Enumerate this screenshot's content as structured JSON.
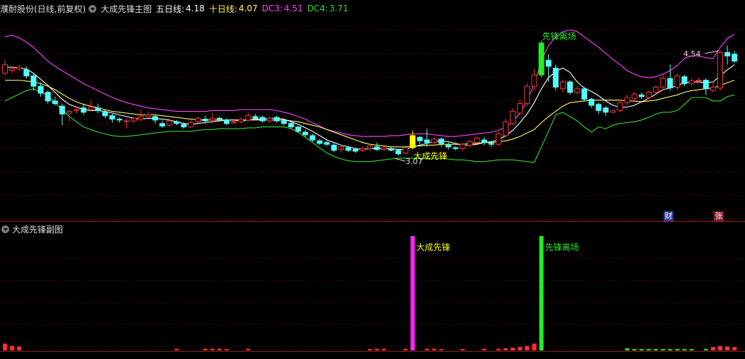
{
  "header": {
    "stock_name": "濮耐股份(日线,前复权)",
    "indicator_name": "大成先锋主图",
    "ma5_label": "五日线:",
    "ma5_value": "4.18",
    "ma10_label": "十日线:",
    "ma10_value": "4.07",
    "dc3_label": "DC3:",
    "dc3_value": "4.51",
    "dc4_label": "DC4:",
    "dc4_value": "3.71"
  },
  "sub_header": {
    "indicator_name": "大成先锋副图"
  },
  "badges": {
    "cai": "财",
    "zhang": "张"
  },
  "colors": {
    "up": "#ff3232",
    "down": "#54ffff",
    "ma5": "#ffffff",
    "ma10": "#ffff66",
    "dc3": "#ff44ff",
    "dc4": "#33dd33",
    "buy": "#ff22ff",
    "sell": "#22ee22",
    "buy_candle": "#ffff00",
    "sell_candle": "#22ee22"
  },
  "chart_data": [
    {
      "type": "candlestick",
      "title": "大成先锋主图",
      "ylim": [
        2.6,
        4.95
      ],
      "ohlc": [
        [
          4.3,
          4.4,
          4.28,
          4.46
        ],
        [
          4.33,
          4.35,
          4.3,
          4.38
        ],
        [
          4.35,
          4.37,
          4.33,
          4.4
        ],
        [
          4.34,
          4.27,
          4.24,
          4.38
        ],
        [
          4.27,
          4.15,
          4.1,
          4.29
        ],
        [
          4.15,
          4.07,
          4.03,
          4.19
        ],
        [
          4.08,
          3.98,
          3.95,
          4.1
        ],
        [
          3.98,
          3.95,
          3.93,
          4.03
        ],
        [
          3.92,
          3.83,
          3.7,
          3.95
        ],
        [
          3.84,
          3.86,
          3.74,
          3.88
        ],
        [
          3.87,
          3.88,
          3.84,
          3.9
        ],
        [
          3.9,
          3.85,
          3.82,
          3.95
        ],
        [
          3.88,
          3.91,
          3.86,
          3.99
        ],
        [
          3.9,
          3.87,
          3.84,
          3.95
        ],
        [
          3.85,
          3.81,
          3.78,
          3.88
        ],
        [
          3.81,
          3.77,
          3.73,
          3.83
        ],
        [
          3.77,
          3.76,
          3.73,
          3.79
        ],
        [
          3.74,
          3.75,
          3.66,
          3.77
        ],
        [
          3.75,
          3.78,
          3.72,
          3.8
        ],
        [
          3.77,
          3.8,
          3.74,
          3.88
        ],
        [
          3.8,
          3.82,
          3.78,
          3.86
        ],
        [
          3.8,
          3.76,
          3.72,
          3.82
        ],
        [
          3.72,
          3.69,
          3.67,
          3.75
        ],
        [
          3.7,
          3.75,
          3.68,
          3.77
        ],
        [
          3.74,
          3.72,
          3.7,
          3.76
        ],
        [
          3.71,
          3.68,
          3.66,
          3.73
        ],
        [
          3.68,
          3.73,
          3.67,
          3.76
        ],
        [
          3.74,
          3.78,
          3.72,
          3.8
        ],
        [
          3.77,
          3.75,
          3.72,
          3.81
        ],
        [
          3.76,
          3.78,
          3.74,
          3.84
        ],
        [
          3.78,
          3.77,
          3.75,
          3.8
        ],
        [
          3.76,
          3.72,
          3.7,
          3.78
        ],
        [
          3.74,
          3.74,
          3.71,
          3.76
        ],
        [
          3.74,
          3.77,
          3.72,
          3.79
        ],
        [
          3.76,
          3.81,
          3.74,
          3.84
        ],
        [
          3.8,
          3.78,
          3.76,
          3.83
        ],
        [
          3.79,
          3.75,
          3.73,
          3.81
        ],
        [
          3.75,
          3.78,
          3.73,
          3.8
        ],
        [
          3.79,
          3.75,
          3.73,
          3.81
        ],
        [
          3.75,
          3.72,
          3.7,
          3.77
        ],
        [
          3.72,
          3.68,
          3.66,
          3.74
        ],
        [
          3.68,
          3.63,
          3.61,
          3.69
        ],
        [
          3.62,
          3.59,
          3.56,
          3.64
        ],
        [
          3.58,
          3.53,
          3.51,
          3.6
        ],
        [
          3.52,
          3.49,
          3.47,
          3.54
        ],
        [
          3.5,
          3.48,
          3.46,
          3.52
        ],
        [
          3.47,
          3.41,
          3.39,
          3.49
        ],
        [
          3.42,
          3.45,
          3.38,
          3.47
        ],
        [
          3.44,
          3.41,
          3.39,
          3.46
        ],
        [
          3.42,
          3.4,
          3.38,
          3.44
        ],
        [
          3.41,
          3.43,
          3.39,
          3.45
        ],
        [
          3.43,
          3.46,
          3.4,
          3.49
        ],
        [
          3.45,
          3.42,
          3.4,
          3.5
        ],
        [
          3.42,
          3.44,
          3.4,
          3.46
        ],
        [
          3.43,
          3.41,
          3.4,
          3.45
        ],
        [
          3.41,
          3.37,
          3.35,
          3.43
        ],
        [
          3.38,
          3.44,
          3.36,
          3.46
        ],
        [
          3.44,
          3.58,
          3.42,
          3.64
        ],
        [
          3.56,
          3.52,
          3.48,
          3.58
        ],
        [
          3.53,
          3.5,
          3.45,
          3.66
        ],
        [
          3.5,
          3.54,
          3.46,
          3.57
        ],
        [
          3.54,
          3.49,
          3.45,
          3.56
        ],
        [
          3.47,
          3.45,
          3.42,
          3.5
        ],
        [
          3.44,
          3.43,
          3.41,
          3.46
        ],
        [
          3.43,
          3.48,
          3.41,
          3.5
        ],
        [
          3.47,
          3.51,
          3.45,
          3.53
        ],
        [
          3.5,
          3.55,
          3.48,
          3.57
        ],
        [
          3.53,
          3.5,
          3.47,
          3.56
        ],
        [
          3.49,
          3.48,
          3.45,
          3.52
        ],
        [
          3.48,
          3.6,
          3.46,
          3.62
        ],
        [
          3.58,
          3.74,
          3.55,
          3.78
        ],
        [
          3.72,
          3.86,
          3.7,
          3.9
        ],
        [
          3.84,
          3.95,
          3.82,
          4.0
        ],
        [
          3.95,
          4.15,
          3.92,
          4.18
        ],
        [
          4.15,
          4.28,
          4.1,
          4.35
        ],
        [
          4.28,
          4.65,
          4.25,
          4.68
        ],
        [
          4.45,
          4.38,
          4.2,
          4.52
        ],
        [
          4.36,
          4.14,
          4.1,
          4.4
        ],
        [
          4.12,
          4.2,
          4.08,
          4.22
        ],
        [
          4.2,
          4.08,
          4.05,
          4.22
        ],
        [
          4.08,
          4.12,
          4.05,
          4.15
        ],
        [
          4.12,
          4.0,
          3.98,
          4.14
        ],
        [
          4.0,
          3.93,
          3.9,
          4.02
        ],
        [
          3.94,
          3.87,
          3.83,
          3.96
        ],
        [
          3.9,
          3.85,
          3.81,
          3.92
        ],
        [
          3.85,
          3.87,
          3.84,
          3.88
        ],
        [
          3.87,
          3.96,
          3.85,
          4.0
        ],
        [
          3.96,
          4.02,
          3.93,
          4.05
        ],
        [
          4.01,
          4.06,
          3.98,
          4.08
        ],
        [
          4.05,
          4.03,
          4.0,
          4.08
        ],
        [
          4.02,
          4.08,
          4.0,
          4.1
        ],
        [
          4.08,
          4.14,
          4.05,
          4.16
        ],
        [
          4.14,
          4.24,
          4.1,
          4.29
        ],
        [
          4.24,
          4.13,
          4.1,
          4.4
        ],
        [
          4.14,
          4.27,
          4.1,
          4.3
        ],
        [
          4.26,
          4.18,
          4.15,
          4.28
        ],
        [
          4.18,
          4.21,
          4.16,
          4.24
        ],
        [
          4.21,
          4.22,
          4.19,
          4.25
        ],
        [
          4.22,
          4.12,
          4.05,
          4.24
        ],
        [
          4.1,
          4.14,
          4.08,
          4.2
        ],
        [
          4.13,
          4.54,
          4.1,
          4.56
        ],
        [
          4.54,
          4.5,
          4.4,
          4.62
        ],
        [
          4.52,
          4.44,
          4.42,
          4.56
        ]
      ],
      "ma5": [
        4.37,
        4.37,
        4.36,
        4.35,
        4.3,
        4.23,
        4.16,
        4.08,
        4.0,
        3.94,
        3.91,
        3.88,
        3.87,
        3.87,
        3.86,
        3.84,
        3.82,
        3.8,
        3.78,
        3.77,
        3.78,
        3.78,
        3.77,
        3.76,
        3.74,
        3.72,
        3.71,
        3.72,
        3.73,
        3.74,
        3.75,
        3.76,
        3.76,
        3.75,
        3.76,
        3.77,
        3.77,
        3.78,
        3.78,
        3.77,
        3.74,
        3.71,
        3.67,
        3.63,
        3.58,
        3.53,
        3.5,
        3.47,
        3.45,
        3.43,
        3.42,
        3.43,
        3.43,
        3.43,
        3.43,
        3.42,
        3.42,
        3.45,
        3.47,
        3.49,
        3.51,
        3.52,
        3.51,
        3.49,
        3.47,
        3.47,
        3.48,
        3.5,
        3.51,
        3.53,
        3.58,
        3.64,
        3.73,
        3.83,
        3.96,
        4.12,
        4.25,
        4.32,
        4.36,
        4.31,
        4.2,
        4.13,
        4.09,
        4.04,
        3.98,
        3.93,
        3.91,
        3.91,
        3.93,
        3.97,
        4.01,
        4.06,
        4.11,
        4.13,
        4.16,
        4.19,
        4.2,
        4.2,
        4.19,
        4.2,
        4.27,
        4.34,
        4.4
      ],
      "ma10": [
        4.22,
        4.22,
        4.22,
        4.21,
        4.2,
        4.18,
        4.15,
        4.11,
        4.06,
        4.01,
        3.97,
        3.94,
        3.92,
        3.9,
        3.88,
        3.86,
        3.85,
        3.84,
        3.83,
        3.82,
        3.82,
        3.82,
        3.81,
        3.8,
        3.79,
        3.78,
        3.77,
        3.76,
        3.76,
        3.76,
        3.76,
        3.76,
        3.76,
        3.76,
        3.76,
        3.76,
        3.76,
        3.76,
        3.76,
        3.76,
        3.75,
        3.74,
        3.72,
        3.7,
        3.68,
        3.65,
        3.62,
        3.59,
        3.56,
        3.53,
        3.5,
        3.48,
        3.47,
        3.46,
        3.45,
        3.45,
        3.45,
        3.46,
        3.46,
        3.47,
        3.47,
        3.48,
        3.48,
        3.48,
        3.48,
        3.49,
        3.49,
        3.5,
        3.5,
        3.51,
        3.52,
        3.54,
        3.57,
        3.61,
        3.65,
        3.73,
        3.8,
        3.86,
        3.92,
        3.96,
        3.97,
        3.98,
        3.99,
        3.99,
        3.99,
        3.99,
        3.99,
        3.98,
        3.98,
        3.97,
        3.98,
        3.99,
        4.01,
        4.03,
        4.05,
        4.08,
        4.1,
        4.11,
        4.12,
        4.13,
        4.16,
        4.19,
        4.22
      ],
      "dc3": [
        4.72,
        4.74,
        4.71,
        4.66,
        4.6,
        4.52,
        4.44,
        4.38,
        4.33,
        4.28,
        4.23,
        4.18,
        4.14,
        4.1,
        4.06,
        4.02,
        3.99,
        3.96,
        3.94,
        3.92,
        3.9,
        3.89,
        3.88,
        3.87,
        3.86,
        3.86,
        3.86,
        3.86,
        3.86,
        3.87,
        3.87,
        3.87,
        3.87,
        3.88,
        3.88,
        3.88,
        3.88,
        3.88,
        3.87,
        3.85,
        3.83,
        3.8,
        3.77,
        3.73,
        3.69,
        3.65,
        3.63,
        3.61,
        3.59,
        3.58,
        3.57,
        3.57,
        3.57,
        3.57,
        3.58,
        3.58,
        3.59,
        3.6,
        3.6,
        3.6,
        3.59,
        3.58,
        3.57,
        3.57,
        3.58,
        3.59,
        3.6,
        3.61,
        3.62,
        3.64,
        3.68,
        3.74,
        3.84,
        3.98,
        4.18,
        4.44,
        4.62,
        4.72,
        4.78,
        4.8,
        4.78,
        4.72,
        4.66,
        4.6,
        4.53,
        4.46,
        4.4,
        4.33,
        4.29,
        4.26,
        4.25,
        4.26,
        4.29,
        4.33,
        4.39,
        4.47,
        4.5,
        4.5,
        4.48,
        4.47,
        4.6,
        4.7,
        4.75
      ],
      "dc4": [
        3.98,
        4.02,
        4.06,
        4.1,
        4.12,
        4.08,
        4.04,
        3.96,
        3.88,
        3.8,
        3.74,
        3.68,
        3.65,
        3.62,
        3.6,
        3.58,
        3.57,
        3.57,
        3.58,
        3.59,
        3.6,
        3.61,
        3.62,
        3.63,
        3.63,
        3.63,
        3.63,
        3.64,
        3.65,
        3.65,
        3.66,
        3.66,
        3.66,
        3.66,
        3.67,
        3.67,
        3.68,
        3.68,
        3.68,
        3.68,
        3.66,
        3.62,
        3.56,
        3.5,
        3.44,
        3.38,
        3.34,
        3.31,
        3.29,
        3.28,
        3.28,
        3.28,
        3.29,
        3.3,
        3.31,
        3.32,
        3.32,
        3.32,
        3.32,
        3.32,
        3.32,
        3.32,
        3.31,
        3.3,
        3.3,
        3.29,
        3.28,
        3.28,
        3.29,
        3.3,
        3.3,
        3.3,
        3.29,
        3.28,
        3.27,
        3.45,
        3.63,
        3.82,
        3.85,
        3.8,
        3.75,
        3.68,
        3.62,
        3.68,
        3.66,
        3.7,
        3.72,
        3.73,
        3.74,
        3.76,
        3.79,
        3.83,
        3.85,
        3.85,
        3.87,
        3.94,
        4.02,
        4.02,
        4.02,
        3.98,
        3.98,
        4.03,
        4.05
      ],
      "annotations": {
        "high_label": "4.54",
        "low_label": "3.07",
        "buy_text": "大成先锋",
        "sell_text": "先锋离场",
        "buy_index": 57,
        "sell_index": 75,
        "high_index": 100,
        "low_index": 55
      }
    },
    {
      "type": "bar",
      "title": "大成先锋副图",
      "buy_signal": {
        "index": 57,
        "label": "大成先锋"
      },
      "sell_signal": {
        "index": 75,
        "label": "先锋离场"
      },
      "small_bars": [
        {
          "i": 0,
          "v": 0.06,
          "c": "up"
        },
        {
          "i": 1,
          "v": 0.04,
          "c": "up"
        },
        {
          "i": 2,
          "v": 0.035,
          "c": "up"
        },
        {
          "i": 24,
          "v": 0.015,
          "c": "up"
        },
        {
          "i": 28,
          "v": 0.015,
          "c": "up"
        },
        {
          "i": 29,
          "v": 0.015,
          "c": "up"
        },
        {
          "i": 30,
          "v": 0.015,
          "c": "up"
        },
        {
          "i": 31,
          "v": 0.012,
          "c": "up"
        },
        {
          "i": 34,
          "v": 0.015,
          "c": "up"
        },
        {
          "i": 51,
          "v": 0.012,
          "c": "up"
        },
        {
          "i": 52,
          "v": 0.015,
          "c": "up"
        },
        {
          "i": 53,
          "v": 0.015,
          "c": "up"
        },
        {
          "i": 56,
          "v": 0.015,
          "c": "up"
        },
        {
          "i": 59,
          "v": 0.015,
          "c": "up"
        },
        {
          "i": 60,
          "v": 0.015,
          "c": "up"
        },
        {
          "i": 61,
          "v": 0.012,
          "c": "up"
        },
        {
          "i": 64,
          "v": 0.012,
          "c": "up"
        },
        {
          "i": 67,
          "v": 0.015,
          "c": "up"
        },
        {
          "i": 69,
          "v": 0.015,
          "c": "up"
        },
        {
          "i": 70,
          "v": 0.02,
          "c": "up"
        },
        {
          "i": 71,
          "v": 0.025,
          "c": "up"
        },
        {
          "i": 72,
          "v": 0.03,
          "c": "up"
        },
        {
          "i": 73,
          "v": 0.04,
          "c": "up"
        },
        {
          "i": 74,
          "v": 0.06,
          "c": "up"
        },
        {
          "i": 87,
          "v": 0.02,
          "c": "sell"
        },
        {
          "i": 88,
          "v": 0.01,
          "c": "sell"
        },
        {
          "i": 89,
          "v": 0.008,
          "c": "sell"
        },
        {
          "i": 90,
          "v": 0.008,
          "c": "sell"
        },
        {
          "i": 91,
          "v": 0.008,
          "c": "sell"
        },
        {
          "i": 92,
          "v": 0.008,
          "c": "sell"
        },
        {
          "i": 93,
          "v": 0.008,
          "c": "sell"
        },
        {
          "i": 94,
          "v": 0.01,
          "c": "sell"
        },
        {
          "i": 95,
          "v": 0.008,
          "c": "sell"
        },
        {
          "i": 96,
          "v": 0.008,
          "c": "sell"
        },
        {
          "i": 98,
          "v": 0.01,
          "c": "sell"
        },
        {
          "i": 99,
          "v": 0.03,
          "c": "up"
        },
        {
          "i": 100,
          "v": 0.04,
          "c": "up"
        },
        {
          "i": 101,
          "v": 0.035,
          "c": "up"
        },
        {
          "i": 102,
          "v": 0.03,
          "c": "up"
        }
      ]
    }
  ]
}
